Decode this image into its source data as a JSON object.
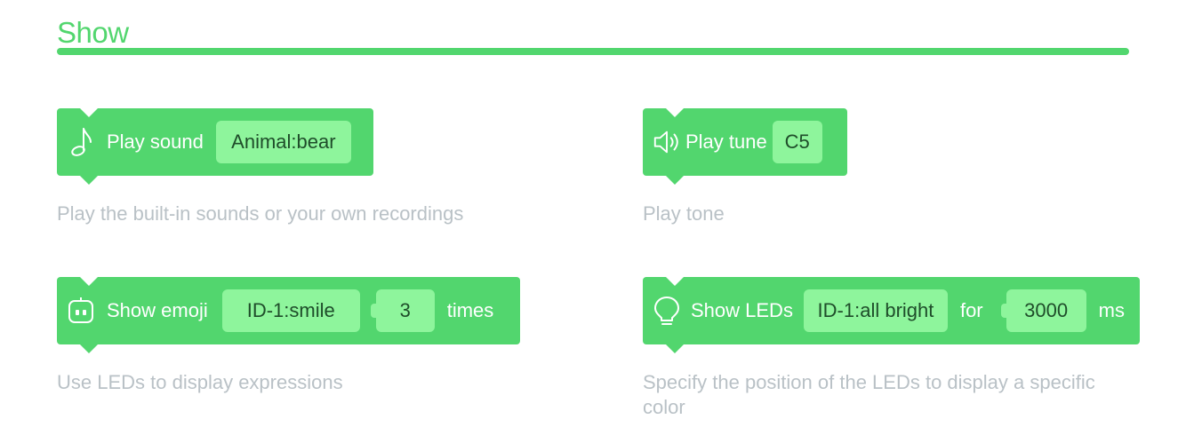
{
  "section": {
    "title": "Show"
  },
  "colors": {
    "block": "#52d66e",
    "pill": "#8ef59c",
    "description": "#b9c1c6"
  },
  "blocks": [
    {
      "icon": "music-note-icon",
      "label": "Play sound",
      "value": "Animal:bear",
      "description": "Play the built-in sounds or your own recordings"
    },
    {
      "icon": "speaker-icon",
      "label": "Play tune",
      "value": "C5",
      "description": "Play tone"
    },
    {
      "icon": "robot-face-icon",
      "label": "Show emoji",
      "value": "ID-1:smile",
      "count": "3",
      "suffix": "times",
      "description": "Use LEDs to display expressions"
    },
    {
      "icon": "light-bulb-icon",
      "label": "Show LEDs",
      "value": "ID-1:all bright",
      "connector": "for",
      "duration": "3000",
      "unit": "ms",
      "description": "Specify the position of the LEDs to display a specific color"
    }
  ]
}
